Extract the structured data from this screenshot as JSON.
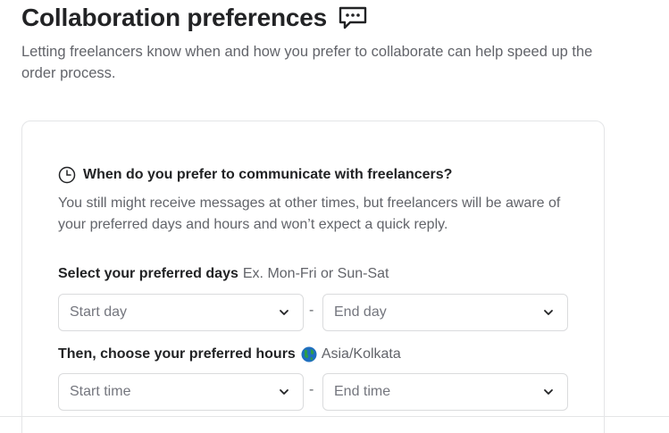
{
  "header": {
    "title": "Collaboration preferences",
    "title_icon": "chat-bubble-dots-icon",
    "intro": "Letting freelancers know when and how you prefer to collaborate can help speed up the order process."
  },
  "communication": {
    "heading": "When do you prefer to communicate with freelancers?",
    "heading_icon": "clock-icon",
    "description": "You still might receive messages at other times, but freelancers will be aware of your preferred days and hours and won’t expect a quick reply."
  },
  "days": {
    "label": "Select your preferred days",
    "hint": "Ex. Mon-Fri or Sun-Sat",
    "start_placeholder": "Start day",
    "separator": "-",
    "end_placeholder": "End day"
  },
  "hours": {
    "label": "Then, choose your preferred hours",
    "timezone_icon": "globe-icon",
    "timezone": "Asia/Kolkata",
    "start_placeholder": "Start time",
    "separator": "-",
    "end_placeholder": "End time"
  },
  "colors": {
    "text_primary": "#222325",
    "text_secondary": "#62646a",
    "border": "#dadbdd"
  }
}
